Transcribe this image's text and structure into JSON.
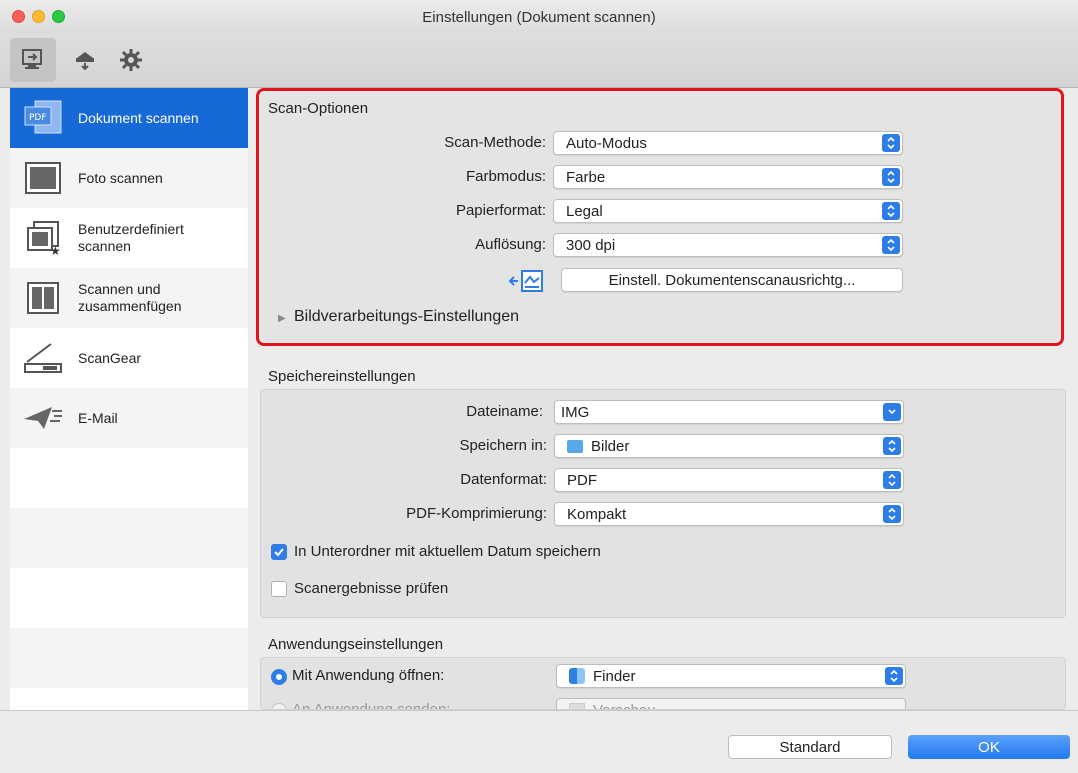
{
  "window": {
    "title": "Einstellungen (Dokument scannen)"
  },
  "toolbar": {
    "items": [
      "scan-from-computer-icon",
      "scan-from-panel-icon",
      "general-settings-gear-icon"
    ]
  },
  "sidebar": {
    "items": [
      {
        "label": "Dokument scannen",
        "icon": "pdf-document-icon",
        "selected": true
      },
      {
        "label": "Foto scannen",
        "icon": "photo-icon"
      },
      {
        "label": "Benutzerdefiniert scannen",
        "icon": "custom-scan-icon"
      },
      {
        "label": "Scannen und zusammenfügen",
        "icon": "stitch-icon"
      },
      {
        "label": "ScanGear",
        "icon": "scangear-icon"
      },
      {
        "label": "E-Mail",
        "icon": "email-icon"
      }
    ]
  },
  "scan_options": {
    "title": "Scan-Optionen",
    "method_label": "Scan-Methode:",
    "method_value": "Auto-Modus",
    "color_label": "Farbmodus:",
    "color_value": "Farbe",
    "paper_label": "Papierformat:",
    "paper_value": "Legal",
    "resolution_label": "Auflösung:",
    "resolution_value": "300 dpi",
    "orientation_button": "Einstell. Dokumentenscanausrichtg...",
    "image_processing_label": "Bildverarbeitungs-Einstellungen"
  },
  "save_settings": {
    "title": "Speichereinstellungen",
    "filename_label": "Dateiname:",
    "filename_value": "IMG",
    "save_in_label": "Speichern in:",
    "save_in_value": "Bilder",
    "format_label": "Datenformat:",
    "format_value": "PDF",
    "compression_label": "PDF-Komprimierung:",
    "compression_value": "Kompakt",
    "subfolder_label": "In Unterordner mit aktuellem Datum speichern",
    "subfolder_checked": true,
    "check_results_label": "Scanergebnisse prüfen",
    "check_results_checked": false
  },
  "app_settings": {
    "title": "Anwendungseinstellungen",
    "open_with_label": "Mit Anwendung öffnen:",
    "open_with_value": "Finder",
    "send_to_label": "An Anwendung senden:",
    "send_to_value": "Vorschau"
  },
  "footer": {
    "standard_button": "Standard",
    "ok_button": "OK"
  },
  "colors": {
    "accent": "#2e7de6",
    "selection": "#1669d6",
    "highlight": "#e0151b"
  }
}
